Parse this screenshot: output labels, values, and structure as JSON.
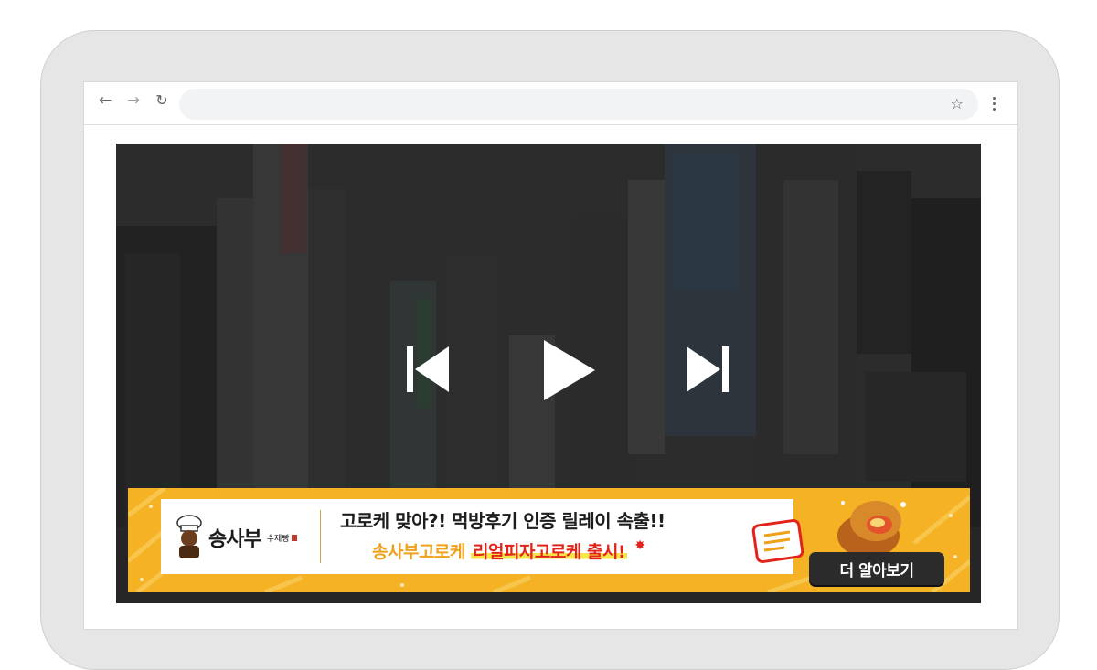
{
  "browser": {
    "back_icon": "arrow-left-icon",
    "forward_icon": "arrow-right-icon",
    "reload_icon": "reload-icon",
    "address": "",
    "bookmark_icon": "star-icon",
    "menu_icon": "vertical-dots-icon"
  },
  "player": {
    "prev_icon": "skip-previous-icon",
    "play_icon": "play-icon",
    "next_icon": "skip-next-icon"
  },
  "ad": {
    "brand_name": "송사부",
    "brand_sub": "수제빵",
    "headline": "고로케 맞아?! 먹방후기 인증 릴레이 속출!!",
    "subline_a": "송사부고로케",
    "subline_b": "리얼피자고로케 출시!",
    "cta_label": "더 알아보기",
    "accent_color": "#f5b225",
    "highlight_color": "#e2231a"
  }
}
